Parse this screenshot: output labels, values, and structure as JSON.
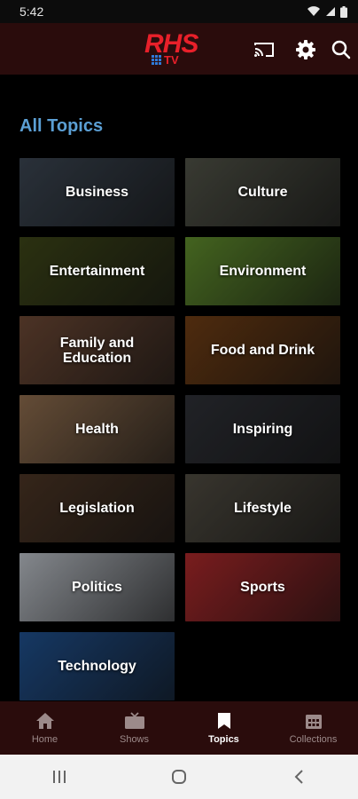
{
  "status": {
    "time": "5:42"
  },
  "brand": {
    "logo_main": "RHS",
    "logo_sub": "TV"
  },
  "page": {
    "title": "All Topics"
  },
  "topics": [
    {
      "label": "Business",
      "bg": "#3a4450"
    },
    {
      "label": "Culture",
      "bg": "#4f5146"
    },
    {
      "label": "Entertainment",
      "bg": "#3c4418"
    },
    {
      "label": "Environment",
      "bg": "#5e8a2c"
    },
    {
      "label": "Family and Education",
      "bg": "#6a4734"
    },
    {
      "label": "Food and Drink",
      "bg": "#6d3c14"
    },
    {
      "label": "Health",
      "bg": "#8b6a4c"
    },
    {
      "label": "Inspiring",
      "bg": "#2e3036"
    },
    {
      "label": "Legislation",
      "bg": "#4a3424"
    },
    {
      "label": "Lifestyle",
      "bg": "#4e4a40"
    },
    {
      "label": "Politics",
      "bg": "#b7bcc3"
    },
    {
      "label": "Sports",
      "bg": "#a8282a"
    },
    {
      "label": "Technology",
      "bg": "#1f4e8a"
    }
  ],
  "nav": {
    "items": [
      {
        "label": "Home",
        "icon": "home-icon"
      },
      {
        "label": "Shows",
        "icon": "tv-icon"
      },
      {
        "label": "Topics",
        "icon": "bookmark-icon"
      },
      {
        "label": "Collections",
        "icon": "calendar-icon"
      }
    ],
    "active": "Topics"
  },
  "colors": {
    "accent": "#5b9fd4",
    "brand_red": "#e8202a",
    "appbar": "#2a0c0c"
  }
}
